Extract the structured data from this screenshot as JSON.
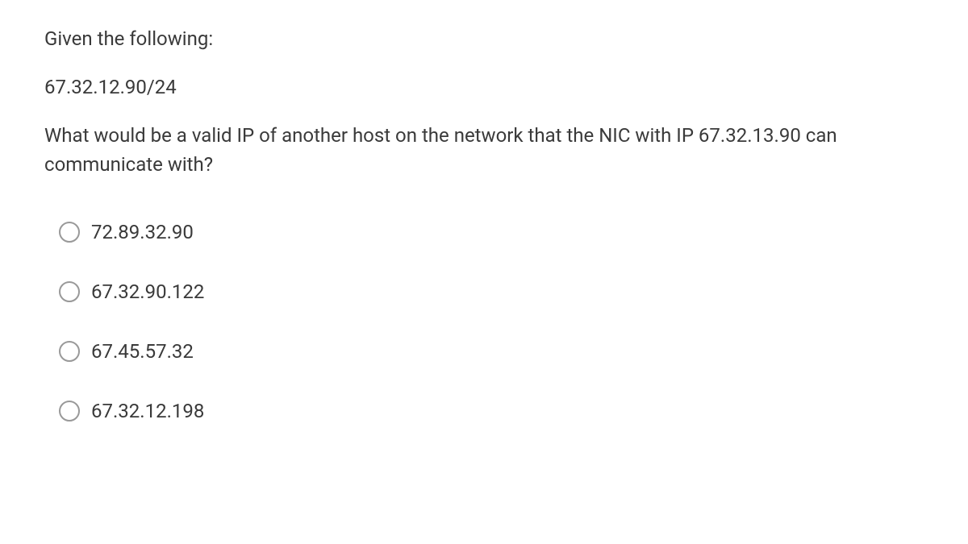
{
  "question": {
    "line1": "Given the following:",
    "line2": "67.32.12.90/24",
    "line3": "What would be a valid IP of another host on the network that the NIC with IP 67.32.13.90 can communicate with?"
  },
  "options": [
    {
      "label": "72.89.32.90"
    },
    {
      "label": "67.32.90.122"
    },
    {
      "label": "67.45.57.32"
    },
    {
      "label": "67.32.12.198"
    }
  ]
}
